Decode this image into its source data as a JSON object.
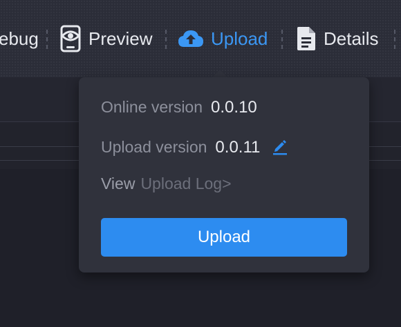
{
  "toolbar": {
    "debug_label": "ebug",
    "preview_label": "Preview",
    "upload_label": "Upload",
    "details_label": "Details"
  },
  "popover": {
    "online_label": "Online version",
    "online_value": "0.0.10",
    "upload_label": "Upload version",
    "upload_value": "0.0.11",
    "view_label": "View",
    "log_link": "Upload Log>",
    "button_label": "Upload"
  },
  "colors": {
    "accent": "#2d8cf0",
    "active_tab": "#3b97f4",
    "background": "#1f2029",
    "popover": "#30323c"
  },
  "icons": [
    "preview-icon",
    "cloud-upload-icon",
    "document-icon",
    "edit-icon"
  ]
}
